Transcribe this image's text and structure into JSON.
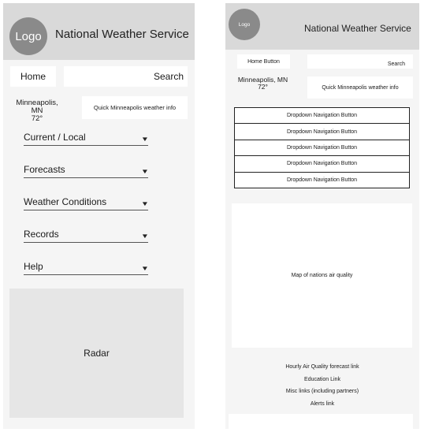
{
  "left": {
    "logo": "Logo",
    "title": "National Weather Service",
    "home_label": "Home",
    "search_label": "Search",
    "location_city": "Minneapolis, MN",
    "location_temp": "72°",
    "quick_info": "Quick Minneapolis weather info",
    "nav_items": [
      {
        "label": "Current / Local"
      },
      {
        "label": "Forecasts"
      },
      {
        "label": "Weather Conditions"
      },
      {
        "label": "Records"
      },
      {
        "label": "Help"
      }
    ],
    "radar_label": "Radar"
  },
  "right": {
    "logo": "Logo",
    "title": "National Weather Service",
    "home_label": "Home Button",
    "search_label": "Search",
    "location_city": "Minneapolis, MN",
    "location_temp": "72°",
    "quick_info": "Quick Minneapolis weather info",
    "dropdowns": [
      {
        "label": "Dropdown Navigation Button"
      },
      {
        "label": "Dropdown Navigation Button"
      },
      {
        "label": "Dropdown Navigation Button"
      },
      {
        "label": "Dropdown Navigation Button"
      },
      {
        "label": "Dropdown Navigation Button"
      }
    ],
    "map_label": "Map of nations air quality",
    "links": [
      {
        "label": "Hourly Air Quality forecast link"
      },
      {
        "label": "Education Link"
      },
      {
        "label": "Misc links (including partners)"
      },
      {
        "label": "Alerts link"
      }
    ]
  },
  "icons": {
    "dropdown": "chevron-down-icon"
  }
}
